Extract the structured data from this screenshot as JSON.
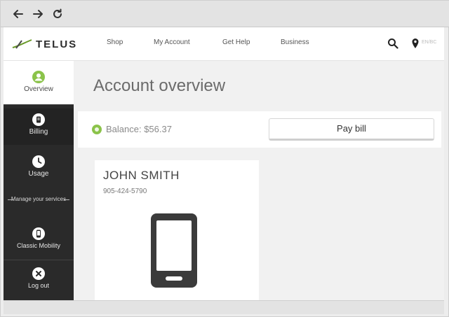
{
  "browser": {
    "back_icon": "arrow-left-icon",
    "forward_icon": "arrow-right-icon",
    "reload_icon": "reload-icon"
  },
  "header": {
    "logo_text": "TELUS",
    "nav": [
      "Shop",
      "My Account",
      "Get Help",
      "Business"
    ],
    "search_icon": "search-icon",
    "location_icon": "location-pin-icon",
    "locale": "EN/BC"
  },
  "sidebar": {
    "items": [
      {
        "label": "Overview",
        "icon": "user-icon",
        "active": true
      },
      {
        "label": "Billing",
        "icon": "bill-icon"
      },
      {
        "label": "Usage",
        "icon": "clock-icon"
      },
      {
        "label": "Classic Mobility",
        "icon": "phone-icon"
      },
      {
        "label": "Log out",
        "icon": "close-circle-icon"
      }
    ],
    "manage_label": "Manage your services"
  },
  "main": {
    "title": "Account overview",
    "balance_label": "Balance: $56.37",
    "pay_button": "Pay bill",
    "card": {
      "name": "JOHN SMITH",
      "phone": "905-424-5790"
    }
  },
  "colors": {
    "accent_green": "#8bc34a",
    "sidebar_bg": "#2a2a2a"
  }
}
